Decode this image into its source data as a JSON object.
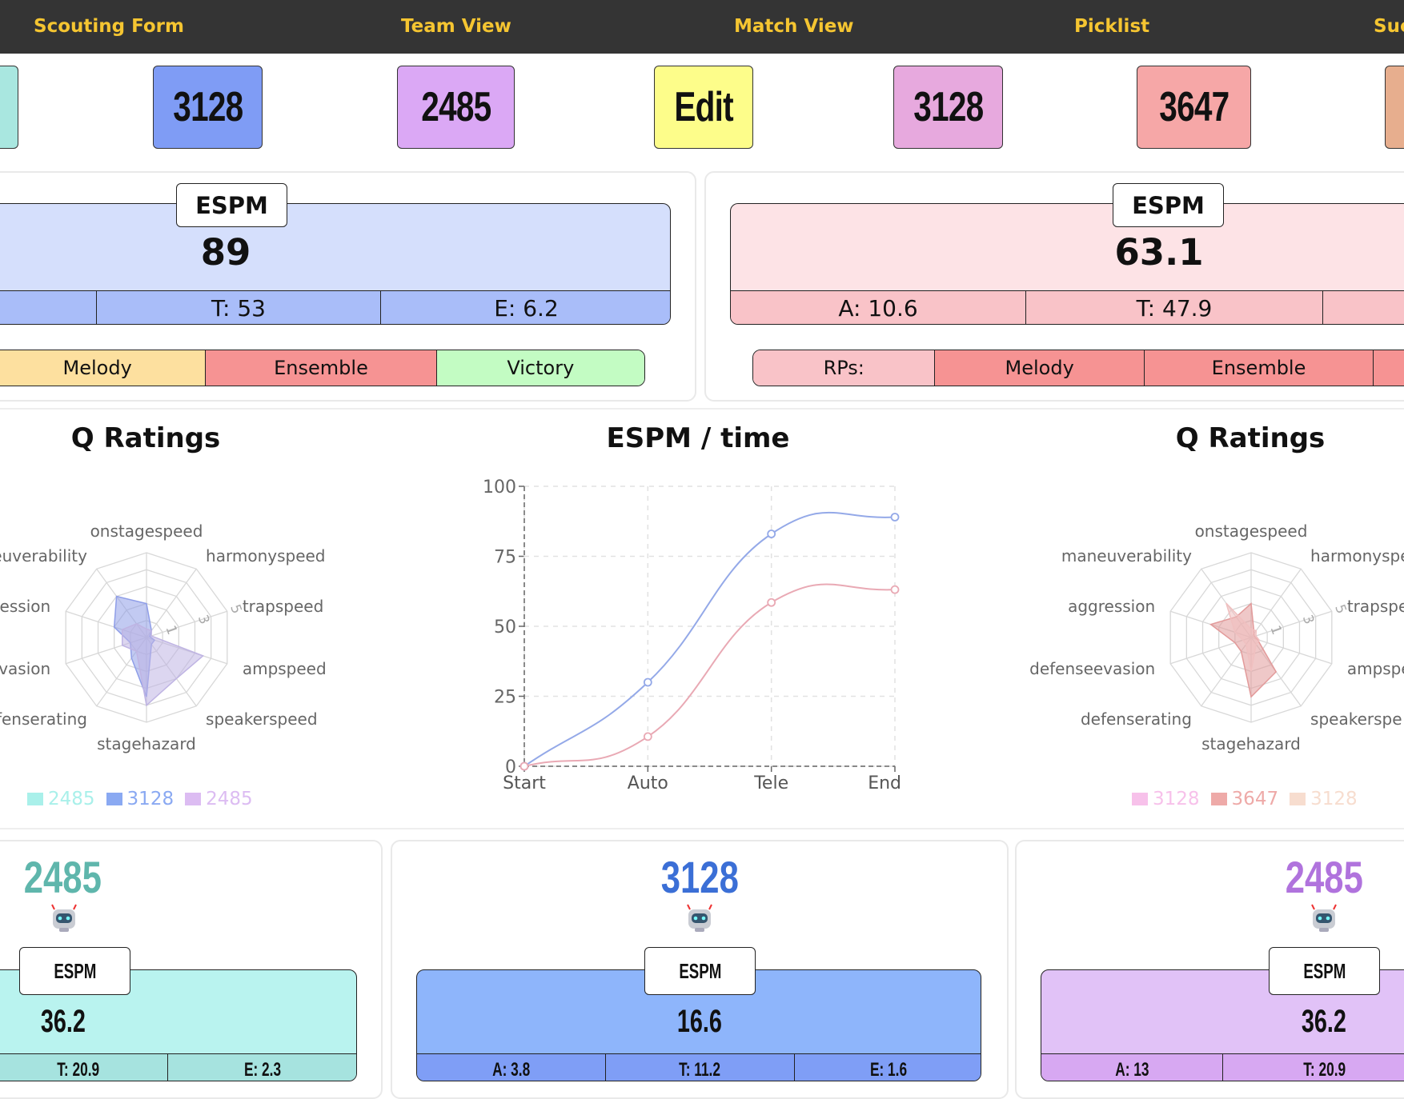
{
  "nav": {
    "links": [
      "Scouting Form",
      "Team View",
      "Match View",
      "Picklist",
      "Suc"
    ]
  },
  "teams_bar": {
    "chips": [
      {
        "label": "",
        "color": "#a9e7e0"
      },
      {
        "label": "3128",
        "color": "#7f9cf5"
      },
      {
        "label": "2485",
        "color": "#dba8f5"
      },
      {
        "label": "Edit",
        "color": "#fdfd8a"
      },
      {
        "label": "3128",
        "color": "#e7a9de"
      },
      {
        "label": "3647",
        "color": "#f6a7a7"
      },
      {
        "label": "",
        "color": "#e7ae8e"
      }
    ]
  },
  "blue_alliance": {
    "tag": "ESPM",
    "value": "89",
    "breakdown": [
      "",
      "T: 53",
      "E: 6.2"
    ],
    "rp_badges": [
      "Melody",
      "Ensemble",
      "Victory"
    ],
    "colors": {
      "panel": "#d5dffc",
      "breakdown": "#a9bdf9"
    }
  },
  "red_alliance": {
    "tag": "ESPM",
    "value": "63.1",
    "breakdown": [
      "A: 10.6",
      "T: 47.9",
      ""
    ],
    "rp_badges": [
      "RPs:",
      "Melody",
      "Ensemble",
      ""
    ],
    "colors": {
      "panel": "#fde3e6",
      "breakdown": "#f9c3c8"
    }
  },
  "charts": {
    "left_radar_title": "Q Ratings",
    "center_title": "ESPM / time",
    "right_radar_title": "Q Ratings",
    "left_radar_labels": [
      "onstagespeed",
      "harmonyspeed",
      "trapspeed",
      "ampspeed",
      "speakerspeed",
      "stagehazard",
      "defenserating",
      "defenseevasion",
      "aggression",
      "maneuverability"
    ],
    "left_radar_label_text": [
      "onstagespeed",
      "harmonyspeed",
      "trapspeed",
      "ampspeed",
      "speakerspeed",
      "stagehazard",
      "efenserating",
      "vasion",
      "ession",
      "euverability"
    ],
    "right_radar_label_text": [
      "onstagespeed",
      "harmonyspe",
      "trapspe",
      "ampspe",
      "speakerspe",
      "stagehazard",
      "defenserating",
      "defenseevasion",
      "aggression",
      "maneuverability"
    ],
    "left_legend": [
      {
        "label": "2485",
        "color": "#a9f0ea"
      },
      {
        "label": "3128",
        "color": "#8aa9f2"
      },
      {
        "label": "2485",
        "color": "#dcbcf2"
      }
    ],
    "right_legend": [
      {
        "label": "3128",
        "color": "#f7c1ea"
      },
      {
        "label": "3647",
        "color": "#eeaaa8"
      },
      {
        "label": "3128",
        "color": "#f7ddcf"
      }
    ],
    "radar_ticks": [
      "1",
      "3",
      "5"
    ]
  },
  "chart_data": [
    {
      "type": "line",
      "title": "ESPM / time",
      "categories": [
        "Start",
        "Auto",
        "Tele",
        "End"
      ],
      "ylim": [
        0,
        100
      ],
      "yticks": [
        "0",
        "25",
        "50",
        "75",
        "100"
      ],
      "series": [
        {
          "values": [
            0,
            30,
            83,
            89
          ],
          "color": "#94a9e8"
        },
        {
          "values": [
            0,
            10.6,
            58.5,
            63.1
          ],
          "color": "#e9a9b4"
        }
      ],
      "grid": true
    },
    {
      "type": "radar",
      "title": "Q Ratings",
      "axes": [
        "onstagespeed",
        "harmonyspeed",
        "trapspeed",
        "ampspeed",
        "speakerspeed",
        "stagehazard",
        "defenserating",
        "defenseevasion",
        "aggression",
        "maneuverability"
      ],
      "rmax": 5,
      "series": [
        {
          "name": "3128",
          "color": "#8f9ee8",
          "values": [
            2,
            0.5,
            0.2,
            0.5,
            0.5,
            3.5,
            1.5,
            1,
            2,
            3
          ]
        },
        {
          "name": "2485",
          "color": "#bfb4e3",
          "values": [
            0.5,
            0.5,
            0.3,
            3.5,
            3,
            4,
            1,
            1.5,
            1.5,
            1
          ]
        }
      ]
    },
    {
      "type": "radar",
      "title": "Q Ratings",
      "axes": [
        "onstagespeed",
        "harmonyspeed",
        "trapspeed",
        "ampspeed",
        "speakerspeed",
        "stagehazard",
        "defenserating",
        "defenseevasion",
        "aggression",
        "maneuverability"
      ],
      "rmax": 5,
      "series": [
        {
          "name": "3647",
          "color": "#e29a9a",
          "values": [
            2,
            0.3,
            0.2,
            0.4,
            2.5,
            3.5,
            1,
            1,
            2.5,
            1.5
          ]
        },
        {
          "name": "3128",
          "color": "#f0c0c0",
          "values": [
            0.5,
            0.5,
            0.3,
            0.5,
            0.5,
            2,
            0.5,
            0.5,
            1,
            2.5
          ]
        }
      ]
    }
  ],
  "team_cards": [
    {
      "number": "2485",
      "number_color": "#5fb6ac",
      "tag": "ESPM",
      "value": "36.2",
      "breakdown": [
        "T: 20.9",
        "E: 2.3"
      ],
      "panel": "#b9f3ef",
      "strip": "#a6e3df"
    },
    {
      "number": "3128",
      "number_color": "#3b6fd6",
      "tag": "ESPM",
      "value": "16.6",
      "breakdown": [
        "A: 3.8",
        "T: 11.2",
        "E: 1.6"
      ],
      "panel": "#8eb5fb",
      "strip": "#7f9ef6"
    },
    {
      "number": "2485",
      "number_color": "#b073dd",
      "tag": "ESPM",
      "value": "36.2",
      "breakdown": [
        "A: 13",
        "T: 20.9"
      ],
      "panel": "#e1c2f7",
      "strip": "#d7a8f2"
    }
  ]
}
